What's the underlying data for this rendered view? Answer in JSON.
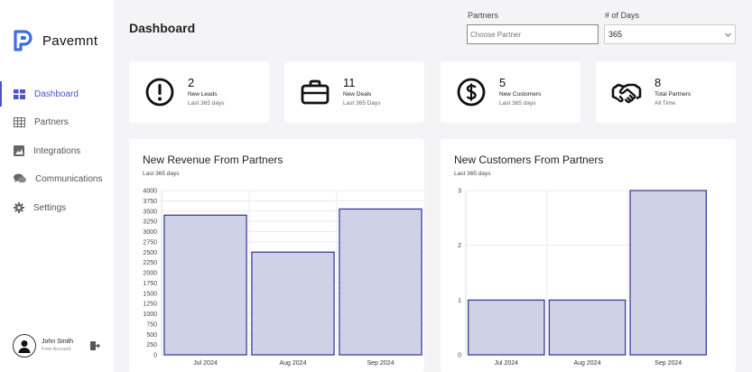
{
  "app": {
    "name": "Pavemnt"
  },
  "sidebar": {
    "items": [
      {
        "label": "Dashboard",
        "icon": "dashboard-grid-icon",
        "active": true
      },
      {
        "label": "Partners",
        "icon": "table-icon"
      },
      {
        "label": "Integrations",
        "icon": "image-icon"
      },
      {
        "label": "Communications",
        "icon": "chat-icon"
      },
      {
        "label": "Settings",
        "icon": "gear-icon"
      }
    ]
  },
  "user": {
    "name": "John Smith",
    "plan": "Free Account"
  },
  "header": {
    "title": "Dashboard",
    "partners_label": "Partners",
    "partners_placeholder": "Choose Partner",
    "days_label": "# of Days",
    "days_value": "365"
  },
  "cards": [
    {
      "value": "2",
      "label": "New Leads",
      "sub": "Last 365 days",
      "icon": "exclamation-circle-icon"
    },
    {
      "value": "11",
      "label": "New Deals",
      "sub": "Last 365 Days",
      "icon": "briefcase-icon"
    },
    {
      "value": "5",
      "label": "New Customers",
      "sub": "Last 365 days",
      "icon": "dollar-circle-icon"
    },
    {
      "value": "8",
      "label": "Total Partners",
      "sub": "All Time",
      "icon": "handshake-icon"
    }
  ],
  "colors": {
    "accent": "#4a55c9",
    "bar_fill": "#cfd1e6",
    "bar_stroke": "#2f3590"
  },
  "chart_data": [
    {
      "type": "bar",
      "title": "New Revenue From Partners",
      "subtitle": "Last 365 days",
      "categories": [
        "Jul 2024",
        "Aug 2024",
        "Sep 2024"
      ],
      "values": [
        3400,
        2500,
        3550
      ],
      "ylim": [
        0,
        4000
      ],
      "yticks": [
        0,
        250,
        500,
        750,
        1000,
        1250,
        1500,
        1750,
        2000,
        2250,
        2500,
        2750,
        3000,
        3250,
        3500,
        3750,
        4000
      ],
      "grid": true
    },
    {
      "type": "bar",
      "title": "New Customers From Partners",
      "subtitle": "Last 365 days",
      "categories": [
        "Jul 2024",
        "Aug 2024",
        "Sep 2024"
      ],
      "values": [
        1,
        1,
        3
      ],
      "ylim": [
        0,
        3
      ],
      "yticks": [
        0,
        1,
        2,
        3
      ],
      "grid": true
    }
  ]
}
